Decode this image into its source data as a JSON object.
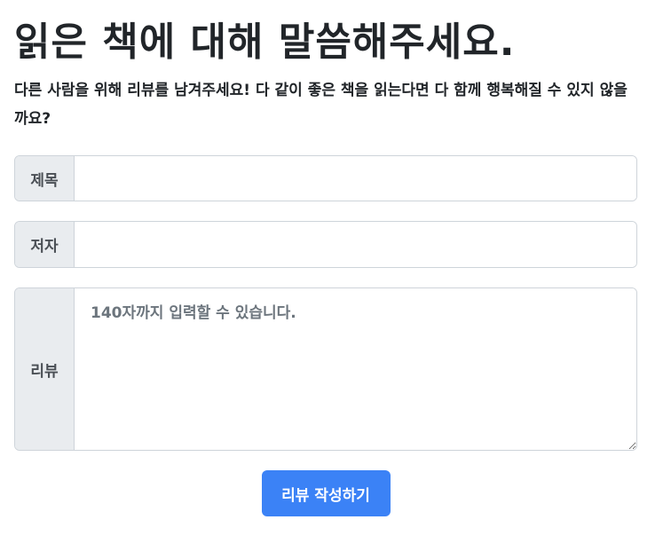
{
  "header": {
    "title": "읽은 책에 대해 말씀해주세요.",
    "subtitle": "다른 사람을 위해 리뷰를 남겨주세요! 다 같이 좋은 책을 읽는다면 다 함께 행복해질 수 있지 않을까요?"
  },
  "form": {
    "title_label": "제목",
    "title_value": "",
    "author_label": "저자",
    "author_value": "",
    "review_label": "리뷰",
    "review_placeholder": "140자까지 입력할 수 있습니다.",
    "submit_label": "리뷰 작성하기"
  },
  "colors": {
    "accent": "#3b82f6",
    "addon_bg": "#e9ecef",
    "border": "#ced4da"
  }
}
